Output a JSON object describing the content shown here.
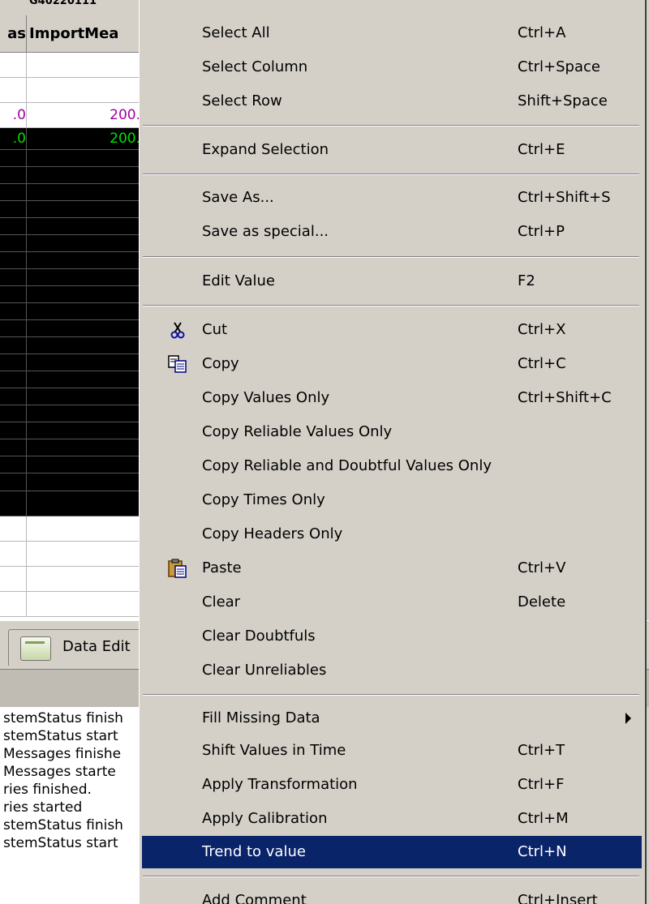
{
  "grid": {
    "top_strip_text": "G40220111",
    "headers": [
      "as",
      "ImportMea"
    ],
    "rows": [
      {
        "c0": "",
        "c1": "",
        "style": "white"
      },
      {
        "c0": "",
        "c1": "",
        "style": "white"
      },
      {
        "c0": ".0",
        "c1": "200.",
        "style": "white-purple"
      },
      {
        "c0": ".0",
        "c1": "200.",
        "style": "dark-green"
      }
    ],
    "colors": {
      "purple": "#a000a0",
      "green": "#00e000",
      "dark_bg": "#000000"
    }
  },
  "tabbar": {
    "tab_label": "Data Edit",
    "icon": "data-editor-icon"
  },
  "log": {
    "lines": [
      "stemStatus finish",
      "stemStatus start",
      "Messages finishe",
      "Messages starte",
      "ries finished.",
      "ries started",
      "stemStatus finish",
      "stemStatus start"
    ]
  },
  "menu": {
    "select_all": {
      "label": "Select All",
      "shortcut": "Ctrl+A"
    },
    "select_column": {
      "label": "Select Column",
      "shortcut": "Ctrl+Space"
    },
    "select_row": {
      "label": "Select Row",
      "shortcut": "Shift+Space"
    },
    "expand_selection": {
      "label": "Expand Selection",
      "shortcut": "Ctrl+E"
    },
    "save_as": {
      "label": "Save As...",
      "shortcut": "Ctrl+Shift+S"
    },
    "save_as_special": {
      "label": "Save as special...",
      "shortcut": "Ctrl+P"
    },
    "edit_value": {
      "label": "Edit Value",
      "shortcut": "F2"
    },
    "cut": {
      "label": "Cut",
      "shortcut": "Ctrl+X",
      "icon": "scissors-icon"
    },
    "copy": {
      "label": "Copy",
      "shortcut": "Ctrl+C",
      "icon": "copy-icon"
    },
    "copy_values_only": {
      "label": "Copy Values Only",
      "shortcut": "Ctrl+Shift+C"
    },
    "copy_reliable": {
      "label": "Copy Reliable Values Only",
      "shortcut": ""
    },
    "copy_reliable_doubtful": {
      "label": "Copy Reliable and Doubtful Values Only",
      "shortcut": ""
    },
    "copy_times": {
      "label": "Copy Times Only",
      "shortcut": ""
    },
    "copy_headers": {
      "label": "Copy Headers Only",
      "shortcut": ""
    },
    "paste": {
      "label": "Paste",
      "shortcut": "Ctrl+V",
      "icon": "clipboard-paste-icon"
    },
    "clear": {
      "label": "Clear",
      "shortcut": "Delete"
    },
    "clear_doubtfuls": {
      "label": "Clear Doubtfuls",
      "shortcut": ""
    },
    "clear_unreliables": {
      "label": "Clear Unreliables",
      "shortcut": ""
    },
    "fill_missing": {
      "label": "Fill Missing Data",
      "shortcut": "",
      "icon": "submenu-arrow-icon"
    },
    "shift_values": {
      "label": "Shift Values in Time",
      "shortcut": "Ctrl+T"
    },
    "apply_transformation": {
      "label": "Apply Transformation",
      "shortcut": "Ctrl+F"
    },
    "apply_calibration": {
      "label": "Apply Calibration",
      "shortcut": "Ctrl+M"
    },
    "trend_to_value": {
      "label": "Trend to value",
      "shortcut": "Ctrl+N",
      "highlighted": true
    },
    "add_comment": {
      "label": "Add Comment",
      "shortcut": "Ctrl+Insert"
    },
    "highlight_color": "#0a246a"
  }
}
